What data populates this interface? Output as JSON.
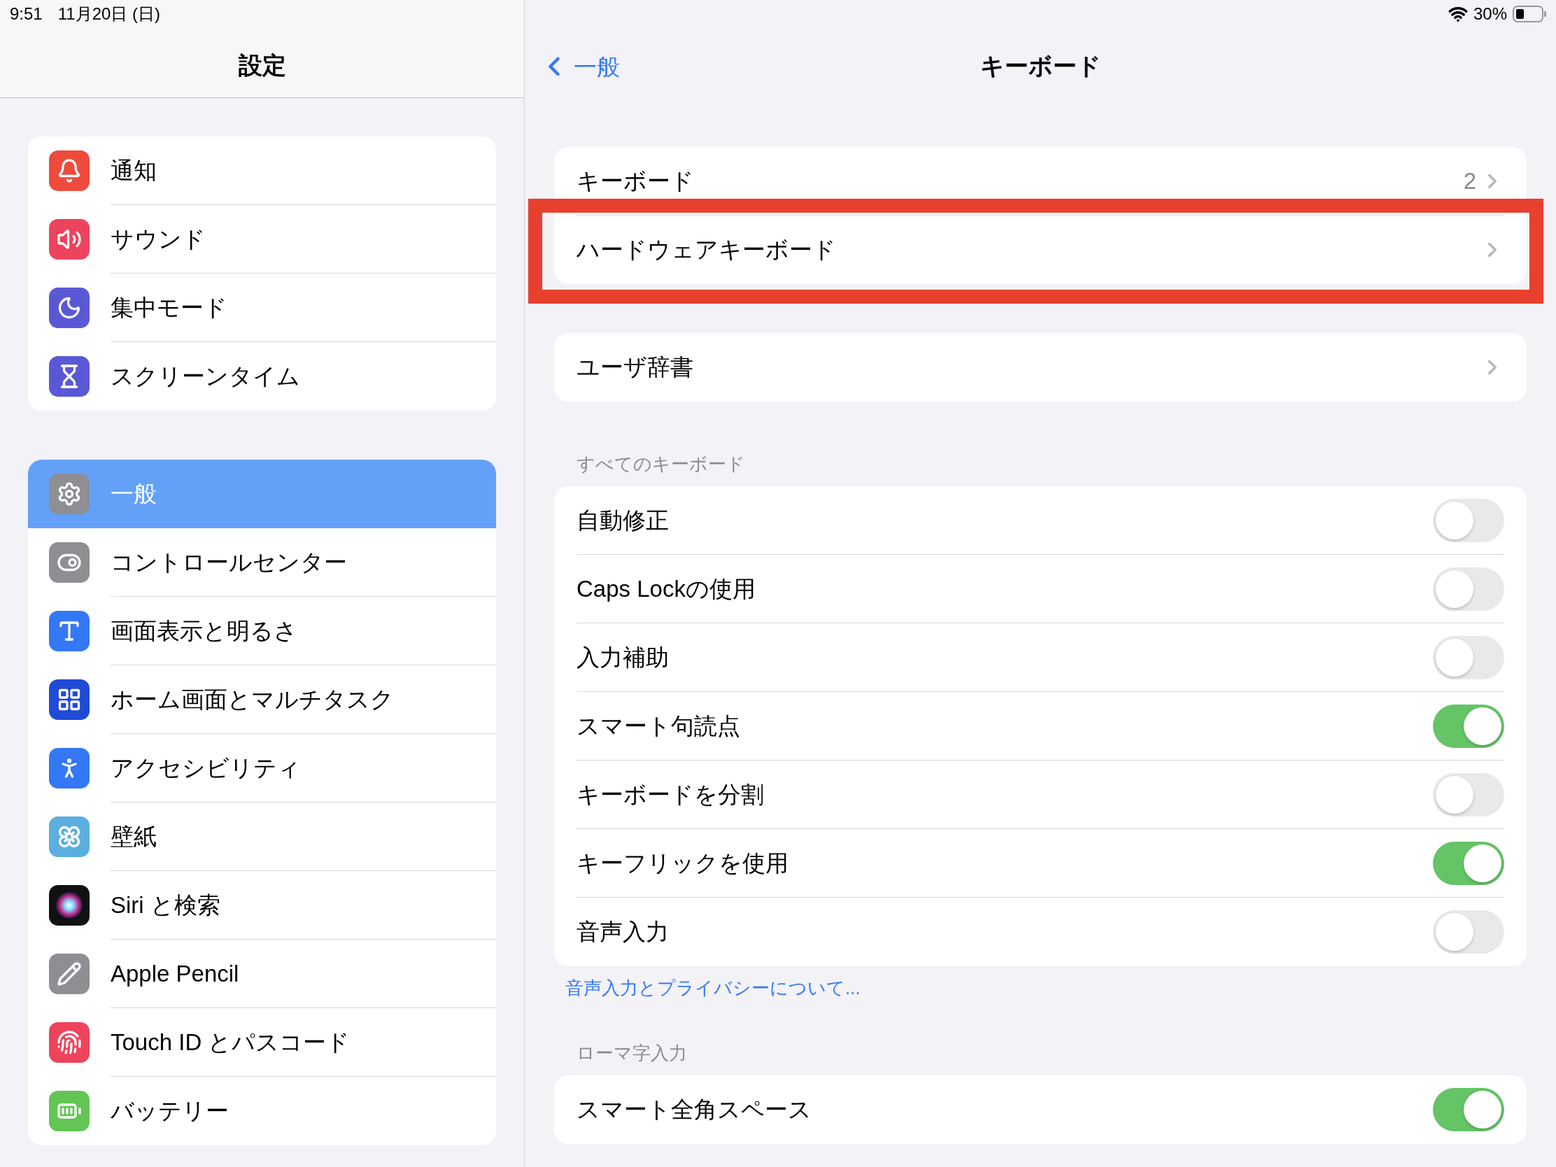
{
  "status_bar": {
    "time": "9:51",
    "date": "11月20日 (日)",
    "battery": "30%"
  },
  "sidebar": {
    "title": "設定",
    "groups": [
      {
        "items": [
          {
            "label": "通知",
            "selected": false
          },
          {
            "label": "サウンド",
            "selected": false
          },
          {
            "label": "集中モード",
            "selected": false
          },
          {
            "label": "スクリーンタイム",
            "selected": false
          }
        ]
      },
      {
        "items": [
          {
            "label": "一般",
            "selected": true
          },
          {
            "label": "コントロールセンター",
            "selected": false
          },
          {
            "label": "画面表示と明るさ",
            "selected": false
          },
          {
            "label": "ホーム画面とマルチタスク",
            "selected": false
          },
          {
            "label": "アクセシビリティ",
            "selected": false
          },
          {
            "label": "壁紙",
            "selected": false
          },
          {
            "label": "Siri と検索",
            "selected": false
          },
          {
            "label": "Apple Pencil",
            "selected": false
          },
          {
            "label": "Touch ID とパスコード",
            "selected": false
          },
          {
            "label": "バッテリー",
            "selected": false
          }
        ]
      }
    ]
  },
  "detail": {
    "back": "一般",
    "title": "キーボード",
    "sections": [
      {
        "rows": [
          {
            "kind": "link",
            "label": "キーボード",
            "value": "2",
            "highlighted": false
          },
          {
            "kind": "link",
            "label": "ハードウェアキーボード",
            "highlighted": true
          }
        ]
      },
      {
        "rows": [
          {
            "kind": "link",
            "label": "ユーザ辞書",
            "highlighted": false
          }
        ]
      },
      {
        "header": "すべてのキーボード",
        "footer_link": "音声入力とプライバシーについて...",
        "rows": [
          {
            "kind": "toggle",
            "label": "自動修正",
            "on": false
          },
          {
            "kind": "toggle",
            "label": "Caps Lockの使用",
            "on": false
          },
          {
            "kind": "toggle",
            "label": "入力補助",
            "on": false
          },
          {
            "kind": "toggle",
            "label": "スマート句読点",
            "on": true
          },
          {
            "kind": "toggle",
            "label": "キーボードを分割",
            "on": false
          },
          {
            "kind": "toggle",
            "label": "キーフリックを使用",
            "on": true
          },
          {
            "kind": "toggle",
            "label": "音声入力",
            "on": false
          }
        ]
      },
      {
        "header": "ローマ字入力",
        "rows": [
          {
            "kind": "toggle",
            "label": "スマート全角スペース",
            "on": true
          }
        ]
      }
    ]
  }
}
